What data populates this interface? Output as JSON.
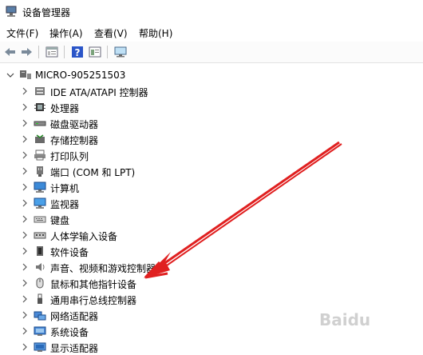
{
  "window": {
    "title": "设备管理器"
  },
  "menu": [
    "文件(F)",
    "操作(A)",
    "查看(V)",
    "帮助(H)"
  ],
  "toolbar": {
    "buttons": [
      "back-arrow-icon",
      "forward-arrow-icon",
      "properties-icon",
      "help-icon",
      "view-icon",
      "monitor-scan-icon"
    ]
  },
  "tree": {
    "root": "MICRO-905251503",
    "items": [
      {
        "label": "IDE ATA/ATAPI 控制器",
        "icon": "ide-controller-icon"
      },
      {
        "label": "处理器",
        "icon": "processor-icon"
      },
      {
        "label": "磁盘驱动器",
        "icon": "disk-drive-icon"
      },
      {
        "label": "存储控制器",
        "icon": "storage-controller-icon"
      },
      {
        "label": "打印队列",
        "icon": "printer-icon"
      },
      {
        "label": "端口 (COM 和 LPT)",
        "icon": "port-icon"
      },
      {
        "label": "计算机",
        "icon": "computer-icon"
      },
      {
        "label": "监视器",
        "icon": "monitor-icon"
      },
      {
        "label": "键盘",
        "icon": "keyboard-icon"
      },
      {
        "label": "人体学输入设备",
        "icon": "hid-icon"
      },
      {
        "label": "软件设备",
        "icon": "software-device-icon"
      },
      {
        "label": "声音、视频和游戏控制器",
        "icon": "speaker-icon"
      },
      {
        "label": "鼠标和其他指针设备",
        "icon": "mouse-icon"
      },
      {
        "label": "通用串行总线控制器",
        "icon": "usb-icon"
      },
      {
        "label": "网络适配器",
        "icon": "network-adapter-icon"
      },
      {
        "label": "系统设备",
        "icon": "system-device-icon"
      },
      {
        "label": "显示适配器",
        "icon": "display-adapter-icon"
      }
    ]
  },
  "annotation": {
    "arrow_color": "#e02020"
  },
  "watermark": "Baidu"
}
